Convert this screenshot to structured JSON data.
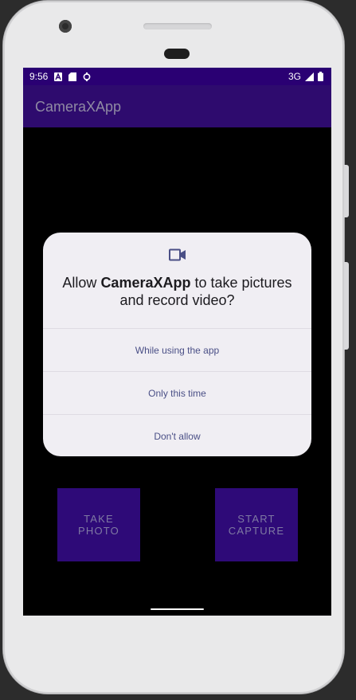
{
  "status_bar": {
    "time": "9:56",
    "network": "3G"
  },
  "app_bar": {
    "title": "CameraXApp"
  },
  "dialog": {
    "icon": "videocam-icon",
    "message_prefix": "Allow ",
    "app_name": "CameraXApp",
    "message_suffix": " to take pictures and record video?",
    "options": [
      "While using the app",
      "Only this time",
      "Don't allow"
    ]
  },
  "buttons": {
    "take_photo": "TAKE\nPHOTO",
    "start_capture": "START\nCAPTURE"
  },
  "colors": {
    "status_bar": "#2a0073",
    "app_bar": "#2e0b6e",
    "button": "#2e0a78",
    "dialog": "#f0eef3",
    "option_text": "#4a4f86"
  }
}
